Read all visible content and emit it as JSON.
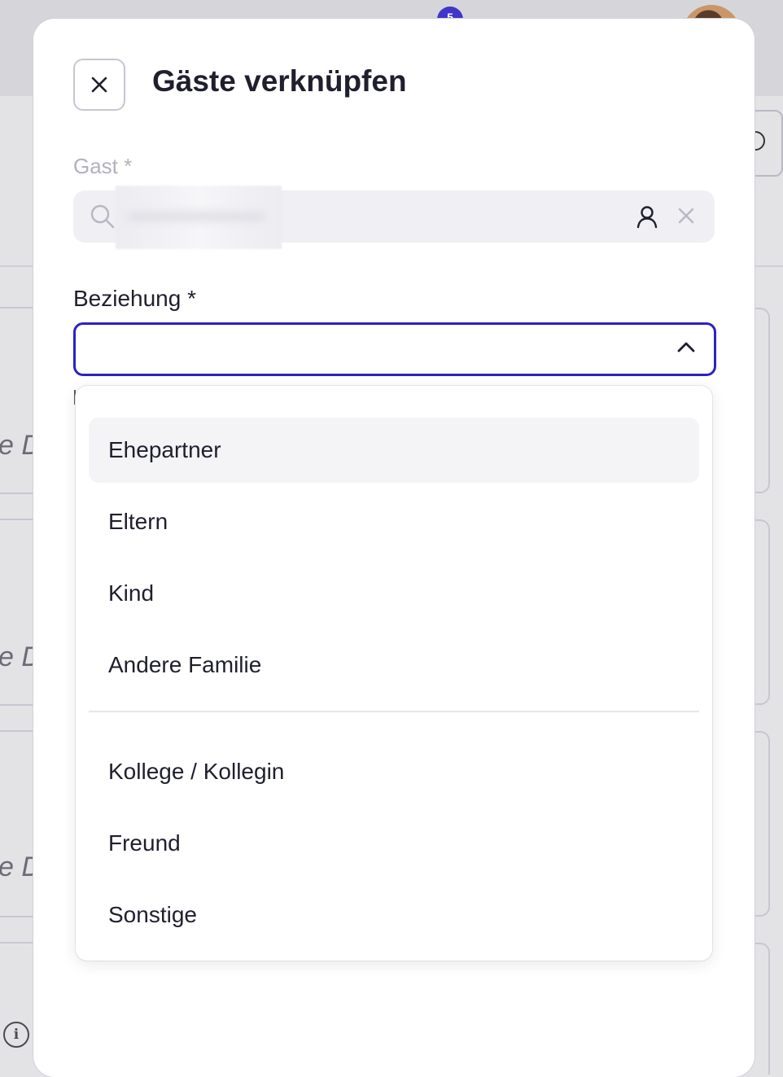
{
  "background": {
    "notification_count": "5",
    "partial_text": "e D"
  },
  "modal": {
    "title": "Gäste verknüpfen",
    "gast": {
      "label": "Gast *",
      "value": ""
    },
    "beziehung": {
      "label": "Beziehung *",
      "value": "",
      "expanded": true
    }
  },
  "dropdown": {
    "groups": [
      {
        "options": [
          {
            "label": "Ehepartner",
            "highlighted": true
          },
          {
            "label": "Eltern",
            "highlighted": false
          },
          {
            "label": "Kind",
            "highlighted": false
          },
          {
            "label": "Andere Familie",
            "highlighted": false
          }
        ]
      },
      {
        "options": [
          {
            "label": "Kollege / Kollegin",
            "highlighted": false
          },
          {
            "label": "Freund",
            "highlighted": false
          },
          {
            "label": "Sonstige",
            "highlighted": false
          }
        ]
      }
    ]
  },
  "colors": {
    "accent": "#2b22c4",
    "badge": "#3f37c9",
    "text": "#1f1f2e",
    "muted": "#b2b2bd"
  },
  "icons": {
    "close": "close-icon",
    "search": "search-icon",
    "person": "person-icon",
    "clear": "clear-icon",
    "chevron": "chevron-up-icon",
    "info": "info-icon"
  }
}
